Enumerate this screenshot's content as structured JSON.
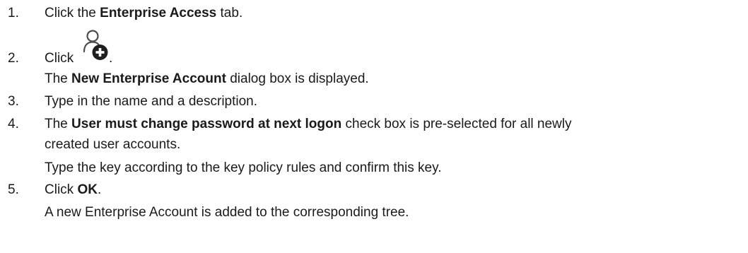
{
  "steps": [
    {
      "number": "1.",
      "pre": "Click the ",
      "bold": "Enterprise Access",
      "post": " tab."
    },
    {
      "number": "2.",
      "text": "Click",
      "icon": "add-user-icon",
      "post": ".",
      "result_pre": "The ",
      "result_bold": "New Enterprise Account",
      "result_post": " dialog box is displayed."
    },
    {
      "number": "3.",
      "text": "Type in the name and a description."
    },
    {
      "number": "4.",
      "pre": "The ",
      "bold": "User must change password at next logon",
      "post": " check box is pre-selected for all newly",
      "continuation": "created user accounts.",
      "extra": "Type the key according to the key policy rules and confirm this key."
    },
    {
      "number": "5.",
      "pre": "Click ",
      "bold": "OK",
      "post": ".",
      "result": "A new Enterprise Account is added to the corresponding tree."
    }
  ]
}
